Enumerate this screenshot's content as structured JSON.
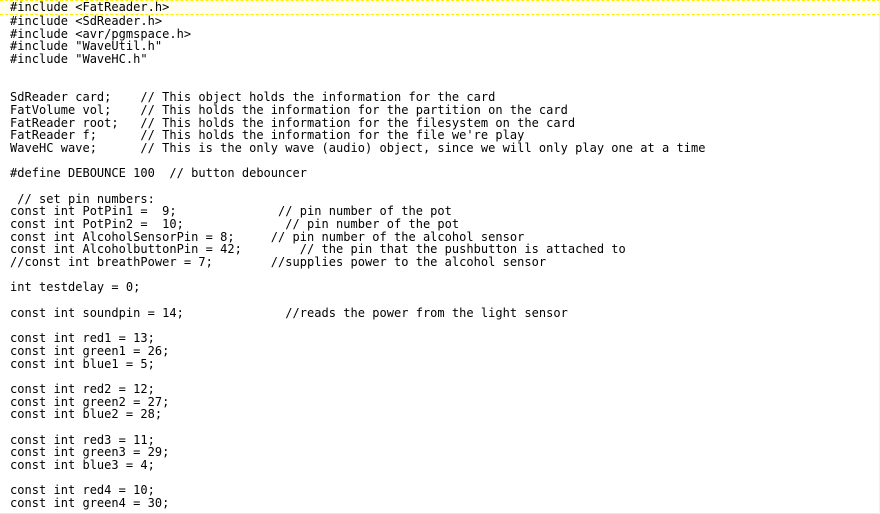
{
  "document": {
    "type": "source-code-listing",
    "language": "arduino-cpp",
    "highlight_color": "#ffee00",
    "highlight_background": "#fffdf0",
    "text_color": "#000000",
    "background_color": "#ffffff",
    "lines": [
      "#include <FatReader.h>",
      "#include <SdReader.h>",
      "#include <avr/pgmspace.h>",
      "#include \"WaveUtil.h\"",
      "#include \"WaveHC.h\"",
      "",
      "",
      "SdReader card;    // This object holds the information for the card",
      "FatVolume vol;    // This holds the information for the partition on the card",
      "FatReader root;   // This holds the information for the filesystem on the card",
      "FatReader f;      // This holds the information for the file we're play",
      "WaveHC wave;      // This is the only wave (audio) object, since we will only play one at a time",
      "",
      "#define DEBOUNCE 100  // button debouncer",
      "",
      " // set pin numbers:",
      "const int PotPin1 =  9;              // pin number of the pot",
      "const int PotPin2 =  10;              // pin number of the pot",
      "const int AlcoholSensorPin = 8;     // pin number of the alcohol sensor",
      "const int AlcoholbuttonPin = 42;        // the pin that the pushbutton is attached to",
      "//const int breathPower = 7;        //supplies power to the alcohol sensor",
      "",
      "int testdelay = 0;",
      "",
      "const int soundpin = 14;              //reads the power from the light sensor",
      "",
      "const int red1 = 13;",
      "const int green1 = 26;",
      "const int blue1 = 5;",
      "",
      "const int red2 = 12;",
      "const int green2 = 27;",
      "const int blue2 = 28;",
      "",
      "const int red3 = 11;",
      "const int green3 = 29;",
      "const int blue3 = 4;",
      "",
      "const int red4 = 10;",
      "const int green4 = 30;"
    ]
  }
}
